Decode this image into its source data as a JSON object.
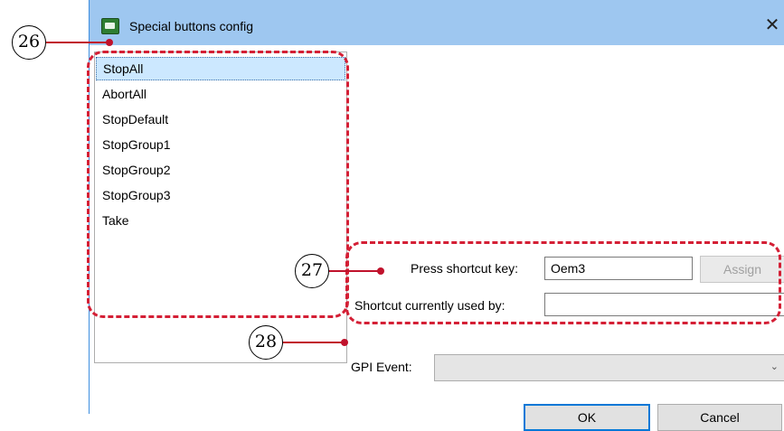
{
  "window": {
    "title": "Special buttons config",
    "close_glyph": "✕",
    "icon": "app-icon"
  },
  "list": {
    "items": [
      "StopAll",
      "AbortAll",
      "StopDefault",
      "StopGroup1",
      "StopGroup2",
      "StopGroup3",
      "Take"
    ],
    "selected": "StopAll"
  },
  "shortcut": {
    "label": "Press shortcut key:",
    "value": "Oem3",
    "assign_label": "Assign"
  },
  "used_by": {
    "label": "Shortcut currently used by:",
    "value": ""
  },
  "gpi": {
    "label": "GPI Event:",
    "value": ""
  },
  "buttons": {
    "ok": "OK",
    "cancel": "Cancel"
  },
  "annotations": {
    "a26": "26",
    "a27": "27",
    "a28": "28"
  },
  "colors": {
    "titlebar": "#9ec7f0",
    "annotation": "#d41f35",
    "selection": "#cce8ff"
  }
}
